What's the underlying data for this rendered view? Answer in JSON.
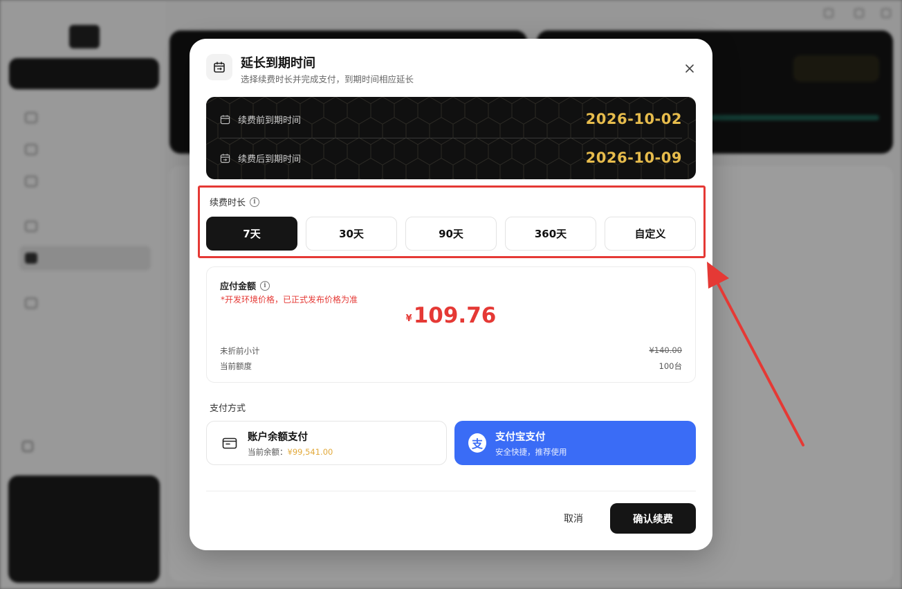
{
  "modal": {
    "title": "延长到期时间",
    "subtitle": "选择续费时长并完成支付，到期时间相应延长",
    "expiry": {
      "before_label": "续费前到期时间",
      "before_date": "2026-10-02",
      "after_label": "续费后到期时间",
      "after_date": "2026-10-09"
    },
    "duration": {
      "label": "续费时长",
      "options": [
        "7天",
        "30天",
        "90天",
        "360天",
        "自定义"
      ],
      "selected": "7天"
    },
    "amount": {
      "label": "应付金额",
      "note": "*开发环境价格，已正式发布价格为准",
      "currency": "¥",
      "value": "109.76",
      "subtotal_label": "未折前小计",
      "subtotal_value": "¥140.00",
      "quota_label": "当前额度",
      "quota_value": "100台"
    },
    "payment": {
      "label": "支付方式",
      "balance_title": "账户余额支付",
      "balance_prefix": "当前余额：",
      "balance_value": "¥99,541.00",
      "alipay_title": "支付宝支付",
      "alipay_desc": "安全快捷，推荐使用",
      "alipay_glyph": "支",
      "selected": "alipay"
    },
    "cancel_label": "取消",
    "confirm_label": "确认续费"
  },
  "icons": {
    "header": "calendar-icon",
    "close": "close-icon",
    "before": "calendar-icon",
    "after": "calendar-check-icon",
    "info": "info-icon",
    "balance": "wallet-icon",
    "alipay": "alipay-icon"
  },
  "colors": {
    "gold": "#e7bc4c",
    "price_red": "#e53935",
    "alipay_blue": "#3a6cf6",
    "annotation_red": "#e53935"
  }
}
